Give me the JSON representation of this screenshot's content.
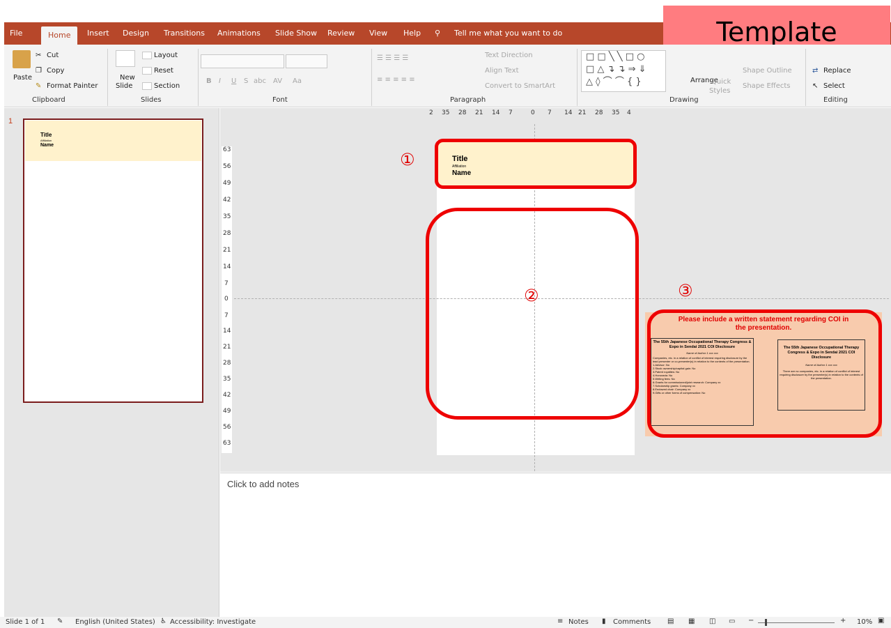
{
  "template_label": "Template",
  "tabs": [
    "File",
    "Home",
    "Insert",
    "Design",
    "Transitions",
    "Animations",
    "Slide Show",
    "Review",
    "View",
    "Help"
  ],
  "tell_me": "Tell me what you want to do",
  "ribbon": {
    "clipboard": {
      "paste": "Paste",
      "cut": "Cut",
      "copy": "Copy",
      "format_painter": "Format Painter",
      "group": "Clipboard"
    },
    "slides": {
      "new_slide": "New",
      "new_slide2": "Slide",
      "layout": "Layout",
      "reset": "Reset",
      "section": "Section",
      "group": "Slides"
    },
    "font": {
      "group": "Font",
      "bold": "B",
      "italic": "I",
      "underline": "U",
      "shadow": "S",
      "strike": "abc",
      "spacing": "AV",
      "case": "Aa"
    },
    "paragraph": {
      "group": "Paragraph",
      "text_direction": "Text Direction",
      "align_text": "Align Text",
      "convert": "Convert to SmartArt"
    },
    "drawing": {
      "group": "Drawing",
      "arrange": "Arrange",
      "quick": "Quick",
      "styles": "Styles",
      "shape_outline": "Shape Outline",
      "shape_effects": "Shape Effects"
    },
    "editing": {
      "group": "Editing",
      "replace": "Replace",
      "select": "Select"
    }
  },
  "ruler": {
    "horizontal": [
      "2",
      "35",
      "28",
      "21",
      "14",
      "7",
      "0",
      "7",
      "14",
      "21",
      "28",
      "35",
      "4"
    ],
    "vertical": [
      "63",
      "56",
      "49",
      "42",
      "35",
      "28",
      "21",
      "14",
      "7",
      "0",
      "7",
      "14",
      "21",
      "28",
      "35",
      "42",
      "49",
      "56",
      "63"
    ]
  },
  "thumbnail": {
    "number": "1",
    "title": "Title",
    "affiliation": "Affiliation",
    "name": "Name"
  },
  "slide_header": {
    "title": "Title",
    "affiliation": "Affiliation",
    "name": "Name"
  },
  "markers": {
    "m1": "①",
    "m2": "②",
    "m3": "③"
  },
  "coi": {
    "statement": "Please include a written statement regarding COI in the presentation.",
    "left_title": "The 55th Japanese Occupational Therapy Congress & Expo in Sendai 2021 COI Disclosure",
    "left_author": "Name of Author 1  xxx xxx",
    "left_body": "Companies, etc. in a relation of conflict of interest requiring disclosure by the lead presenter or co-presenter(s) in relation to the contents of the presentation.",
    "left_items": [
      "1.Advisor:  No",
      "2.Stock ownership/capital gain:  No",
      "3.Patent royalties:  No",
      "4.Honoraria:  No",
      "5.Writing fees:  No",
      "6.Grants for commissioned/joint research:  Company xx",
      "7.Scholarship grants:  Company xx",
      "8.Endowed chair:  Company xx",
      "9.Gifts or other forms of compensation: No"
    ],
    "right_title": "The 55th Japanese Occupational Therapy Congress & Expo in Sendai 2021 COI Disclosure",
    "right_author": "Name of Author 1  xxx xxx",
    "right_body": "There are no companies, etc. in a relation of conflict of interest requiring disclosure by the presenter(s) in relation to the contents of the presentation."
  },
  "notes_placeholder": "Click to add notes",
  "status": {
    "slide": "Slide 1 of 1",
    "language": "English (United States)",
    "accessibility": "Accessibility: Investigate",
    "notes": "Notes",
    "comments": "Comments",
    "zoom": "10%"
  }
}
